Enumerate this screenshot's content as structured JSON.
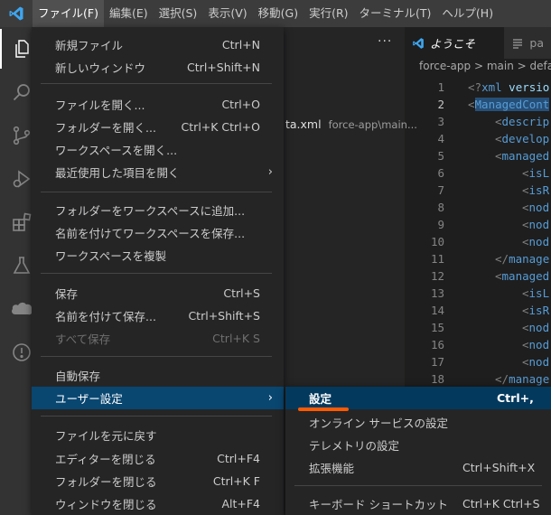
{
  "menubar": {
    "items": [
      {
        "label": "ファイル(F)",
        "active": true
      },
      {
        "label": "編集(E)"
      },
      {
        "label": "選択(S)"
      },
      {
        "label": "表示(V)"
      },
      {
        "label": "移動(G)"
      },
      {
        "label": "実行(R)"
      },
      {
        "label": "ターミナル(T)"
      },
      {
        "label": "ヘルプ(H)"
      }
    ]
  },
  "activitybar": {
    "icons": [
      "explorer-icon",
      "search-icon",
      "source-control-icon",
      "run-debug-icon",
      "extensions-icon",
      "testing-icon",
      "salesforce-icon",
      "info-icon"
    ]
  },
  "sidebar": {
    "more": "···",
    "fragment_file": "ta.xml",
    "fragment_path": "force-app\\main..."
  },
  "editor": {
    "tabs": [
      {
        "label": "ようこそ",
        "icon": "vscode-logo-icon",
        "active": true
      },
      {
        "label": "pa",
        "icon": "file-lines-icon"
      }
    ],
    "breadcrumbs": "force-app > main > defau",
    "current_line": 2,
    "lines": [
      {
        "n": "1",
        "text": "<?xml versio"
      },
      {
        "n": "2",
        "text": "<ManagedCont"
      },
      {
        "n": "3",
        "text": "<descrip"
      },
      {
        "n": "4",
        "text": "<develop"
      },
      {
        "n": "5",
        "text": "<managed"
      },
      {
        "n": "6",
        "text": "<isL"
      },
      {
        "n": "7",
        "text": "<isR"
      },
      {
        "n": "8",
        "text": "<nod"
      },
      {
        "n": "9",
        "text": "<nod"
      },
      {
        "n": "10",
        "text": "<nod"
      },
      {
        "n": "11",
        "text": "</manage"
      },
      {
        "n": "12",
        "text": "<managed"
      },
      {
        "n": "13",
        "text": "<isL"
      },
      {
        "n": "14",
        "text": "<isR"
      },
      {
        "n": "15",
        "text": "<nod"
      },
      {
        "n": "16",
        "text": "<nod"
      },
      {
        "n": "17",
        "text": "<nod"
      },
      {
        "n": "18",
        "text": "</manage"
      }
    ]
  },
  "file_menu": {
    "items": [
      {
        "label": "新規ファイル",
        "shortcut": "Ctrl+N"
      },
      {
        "label": "新しいウィンドウ",
        "shortcut": "Ctrl+Shift+N"
      },
      {
        "label": "ファイルを開く...",
        "shortcut": "Ctrl+O"
      },
      {
        "label": "フォルダーを開く...",
        "shortcut": "Ctrl+K Ctrl+O"
      },
      {
        "label": "ワークスペースを開く...",
        "shortcut": ""
      },
      {
        "label": "最近使用した項目を開く",
        "shortcut": "",
        "submenu": true
      },
      {
        "label": "フォルダーをワークスペースに追加...",
        "shortcut": ""
      },
      {
        "label": "名前を付けてワークスペースを保存...",
        "shortcut": ""
      },
      {
        "label": "ワークスペースを複製",
        "shortcut": ""
      },
      {
        "label": "保存",
        "shortcut": "Ctrl+S"
      },
      {
        "label": "名前を付けて保存...",
        "shortcut": "Ctrl+Shift+S"
      },
      {
        "label": "すべて保存",
        "shortcut": "Ctrl+K S",
        "disabled": true
      },
      {
        "label": "自動保存",
        "shortcut": ""
      },
      {
        "label": "ユーザー設定",
        "shortcut": "",
        "submenu": true,
        "selected": true
      },
      {
        "label": "ファイルを元に戻す",
        "shortcut": ""
      },
      {
        "label": "エディターを閉じる",
        "shortcut": "Ctrl+F4"
      },
      {
        "label": "フォルダーを閉じる",
        "shortcut": "Ctrl+K F"
      },
      {
        "label": "ウィンドウを閉じる",
        "shortcut": "Alt+F4"
      }
    ]
  },
  "user_settings_submenu": {
    "items": [
      {
        "label": "設定",
        "shortcut": "Ctrl+,",
        "selected": true
      },
      {
        "label": "オンライン サービスの設定",
        "shortcut": ""
      },
      {
        "label": "テレメトリの設定",
        "shortcut": ""
      },
      {
        "label": "拡張機能",
        "shortcut": "Ctrl+Shift+X"
      },
      {
        "label": "キーボード ショートカット",
        "shortcut": "Ctrl+K Ctrl+S"
      }
    ]
  },
  "colors": {
    "menubar": "#3c3c3c",
    "menu_bg": "#252526",
    "selection": "#094771",
    "annotation": "#ff5a00"
  }
}
